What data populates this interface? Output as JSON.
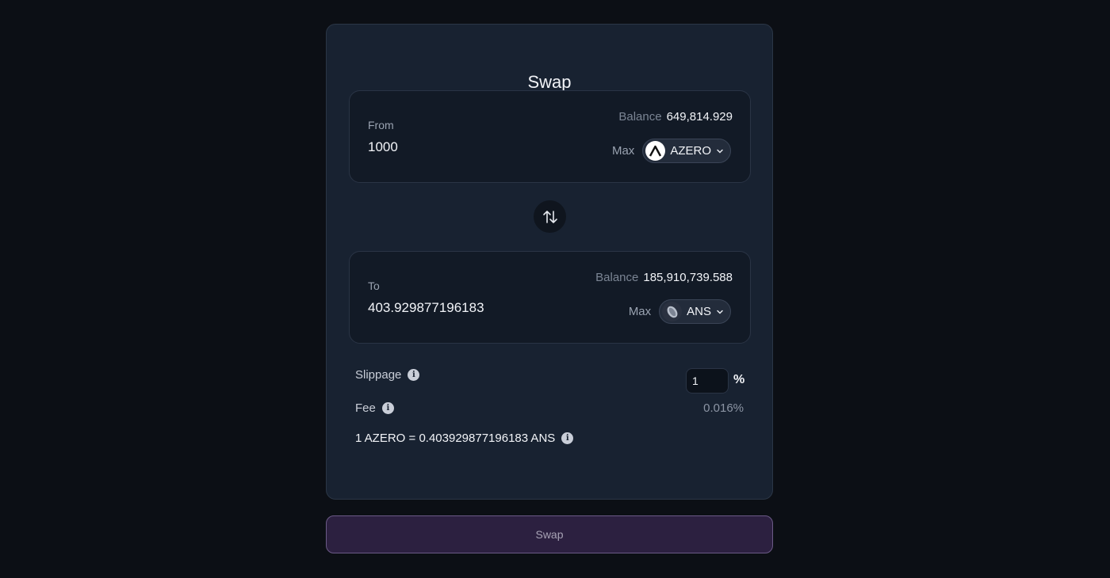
{
  "title": "Swap",
  "from": {
    "label": "From",
    "amount": "1000",
    "balance_label": "Balance",
    "balance_value": "649,814.929",
    "max_label": "Max",
    "token": "AZERO",
    "token_icon": "azero-logo-icon"
  },
  "to": {
    "label": "To",
    "amount": "403.929877196183",
    "balance_label": "Balance",
    "balance_value": "185,910,739.588",
    "max_label": "Max",
    "token": "ANS",
    "token_icon": "ans-logo-icon"
  },
  "settings": {
    "slippage_label": "Slippage",
    "slippage_value": "1",
    "slippage_unit": "%",
    "fee_label": "Fee",
    "fee_value": "0.016%",
    "rate_text": "1 AZERO = 0.403929877196183 ANS"
  },
  "swap_button_label": "Swap",
  "colors": {
    "background": "#0c0f15",
    "card": "#182231",
    "panel": "#121a26",
    "button": "#2c2040",
    "button_border": "#6b5a86"
  }
}
